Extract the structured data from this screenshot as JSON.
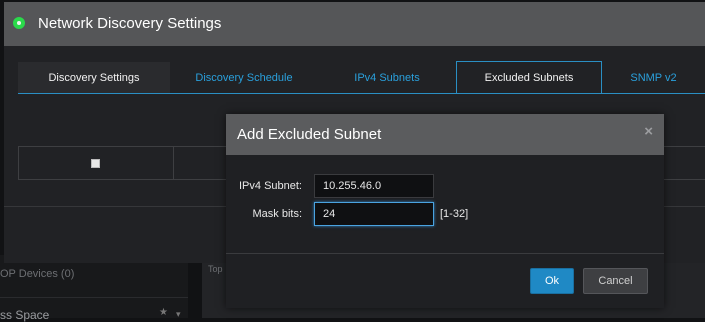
{
  "window": {
    "title": "Network Discovery Settings",
    "tabs": [
      {
        "label": "Discovery Settings",
        "state": "dim"
      },
      {
        "label": "Discovery Schedule",
        "state": "link"
      },
      {
        "label": "IPv4 Subnets",
        "state": "link"
      },
      {
        "label": "Excluded Subnets",
        "state": "active"
      },
      {
        "label": "SNMP v2",
        "state": "link"
      }
    ]
  },
  "background": {
    "left_item_1": "OP Devices (0)",
    "left_item_2": "ss Space",
    "right_label": "Top"
  },
  "modal": {
    "title": "Add Excluded Subnet",
    "close_glyph": "×",
    "fields": {
      "subnet_label": "IPv4 Subnet:",
      "subnet_value": "10.255.46.0",
      "mask_label": "Mask bits:",
      "mask_value": "24",
      "mask_hint": "[1-32]"
    },
    "ok_label": "Ok",
    "cancel_label": "Cancel"
  },
  "colors": {
    "accent": "#2aa0dc",
    "ok_button": "#1f89c5",
    "status_icon": "#2bd94b"
  }
}
